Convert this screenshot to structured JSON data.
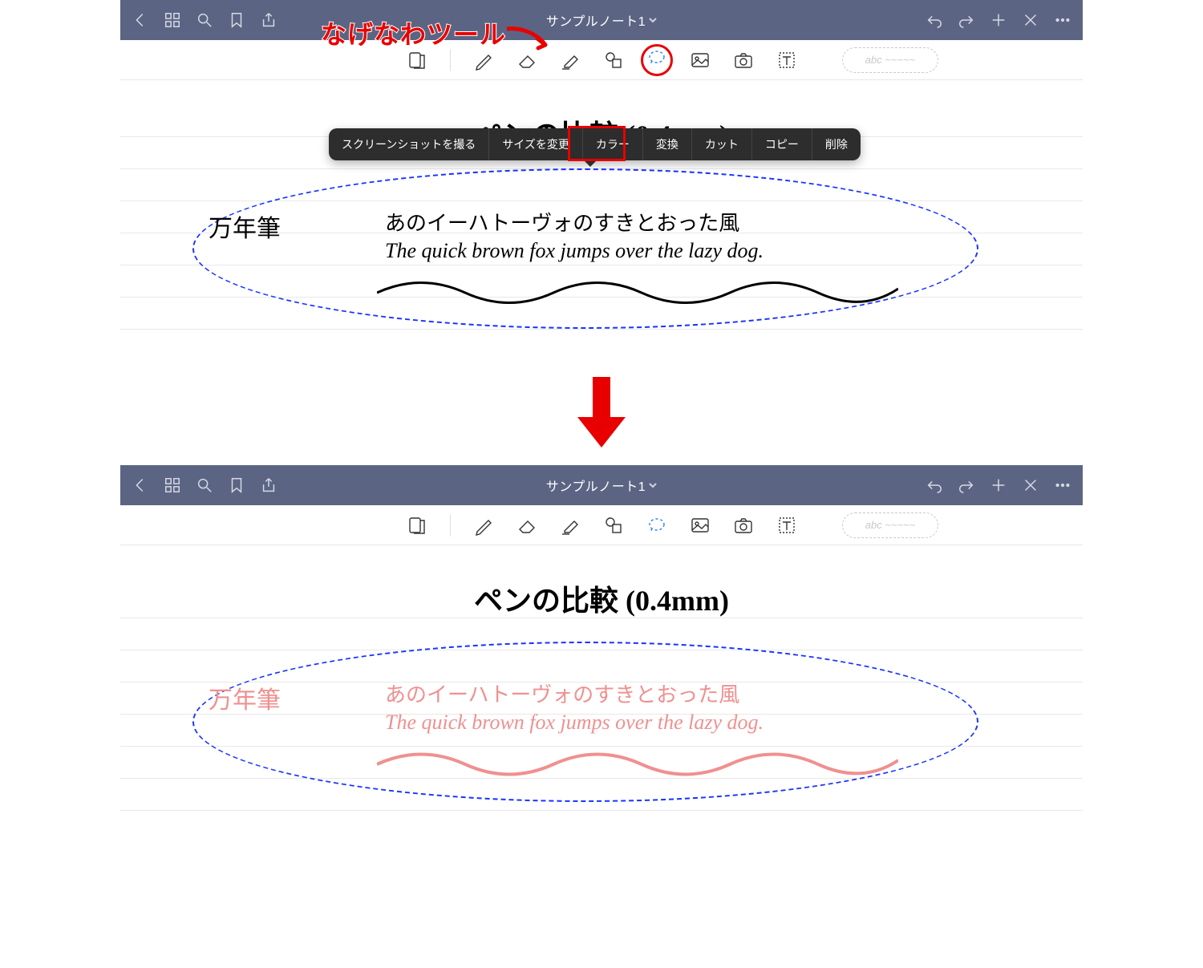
{
  "annotation": {
    "lasso_label": "なげなわツール"
  },
  "top": {
    "titlebar": {
      "title": "サンプルノート1"
    },
    "toolbar": {
      "preset_placeholder": "abc ~~~~~"
    },
    "context_menu": {
      "items": [
        "スクリーンショットを撮る",
        "サイズを変更",
        "カラー",
        "変換",
        "カット",
        "コピー",
        "削除"
      ],
      "highlighted_index": 2
    },
    "canvas": {
      "title_line": "ペンの比較 (0.4mm)",
      "label_left": "万年筆",
      "line1": "あのイーハトーヴォのすきとおった風",
      "line2": "The quick brown fox jumps over the lazy dog."
    }
  },
  "bottom": {
    "titlebar": {
      "title": "サンプルノート1"
    },
    "toolbar": {
      "preset_placeholder": "abc ~~~~~"
    },
    "canvas": {
      "title_line": "ペンの比較 (0.4mm)",
      "label_left": "万年筆",
      "line1": "あのイーハトーヴォのすきとおった風",
      "line2": "The quick brown fox jumps over the lazy dog."
    }
  }
}
